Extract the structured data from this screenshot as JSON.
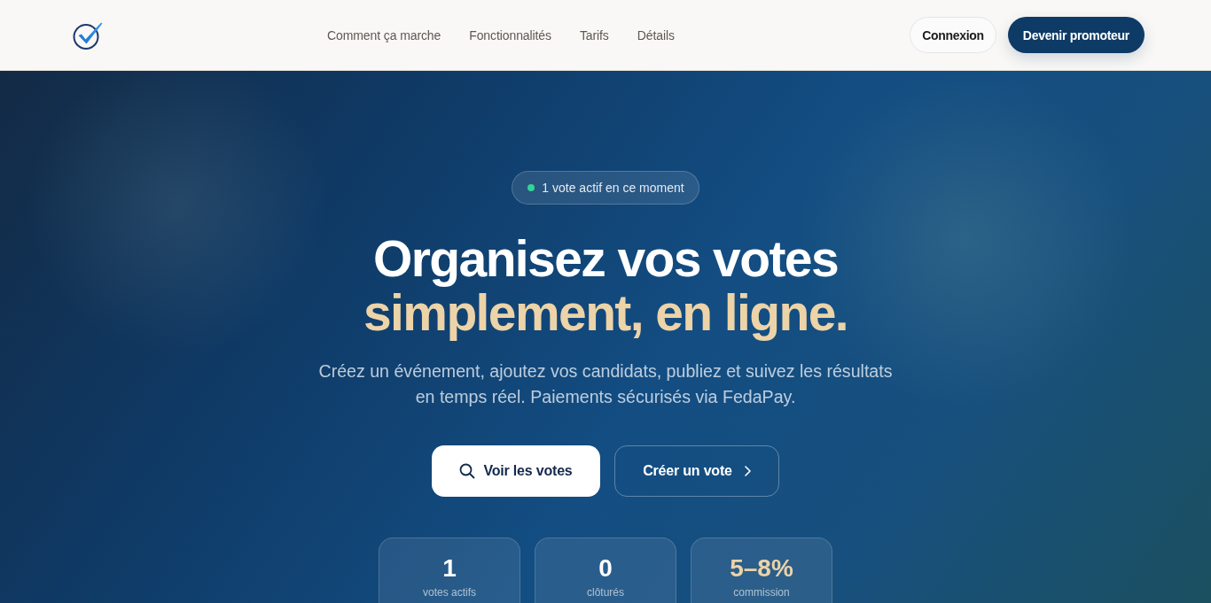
{
  "header": {
    "nav": [
      "Comment ça marche",
      "Fonctionnalités",
      "Tarifs",
      "Détails"
    ],
    "buttons": [
      {
        "label": "Connexion",
        "kind": "outline"
      },
      {
        "label": "Devenir promoteur",
        "kind": "primary"
      }
    ]
  },
  "hero": {
    "badge": "1 vote actif en ce moment",
    "title": "Organisez vos votes",
    "title_accent": "simplement, en ligne.",
    "subtitle": "Créez un événement, ajoutez vos candidats, publiez et suivez les résultats en temps réel. Paiements sécurisés via FedaPay.",
    "actions": [
      {
        "label": "Voir les votes",
        "kind": "primary"
      },
      {
        "label": "Créer un vote",
        "kind": "outline"
      }
    ]
  },
  "stats": [
    {
      "value": "1",
      "label": "votes actifs",
      "accent": false
    },
    {
      "value": "0",
      "label": "clôturés",
      "accent": false
    },
    {
      "value": "5–8%",
      "label": "commission",
      "accent": true
    }
  ]
}
